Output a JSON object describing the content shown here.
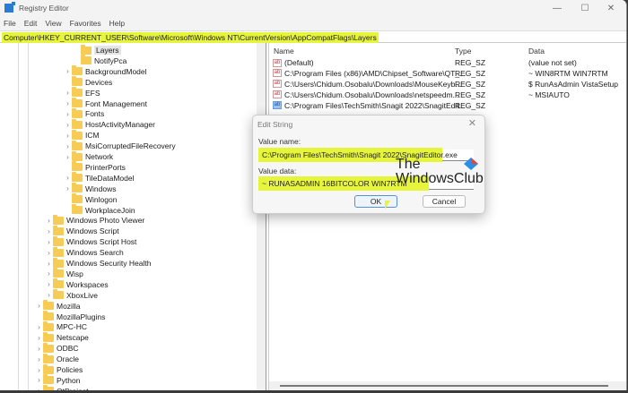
{
  "window": {
    "title": "Registry Editor",
    "minimize": "—",
    "maximize": "☐",
    "close": "✕"
  },
  "menu": [
    "File",
    "Edit",
    "View",
    "Favorites",
    "Help"
  ],
  "address": "Computer\\HKEY_CURRENT_USER\\Software\\Microsoft\\Windows NT\\CurrentVersion\\AppCompatFlags\\Layers",
  "tree": [
    {
      "label": "Layers",
      "level": 3,
      "exp": false,
      "selected": true
    },
    {
      "label": "NotifyPca",
      "level": 3,
      "exp": false
    },
    {
      "label": "BackgroundModel",
      "level": 2,
      "exp": true
    },
    {
      "label": "Devices",
      "level": 2,
      "exp": false
    },
    {
      "label": "EFS",
      "level": 2,
      "exp": true
    },
    {
      "label": "Font Management",
      "level": 2,
      "exp": true
    },
    {
      "label": "Fonts",
      "level": 2,
      "exp": true
    },
    {
      "label": "HostActivityManager",
      "level": 2,
      "exp": true
    },
    {
      "label": "ICM",
      "level": 2,
      "exp": true
    },
    {
      "label": "MsiCorruptedFileRecovery",
      "level": 2,
      "exp": true
    },
    {
      "label": "Network",
      "level": 2,
      "exp": true
    },
    {
      "label": "PrinterPorts",
      "level": 2,
      "exp": false
    },
    {
      "label": "TileDataModel",
      "level": 2,
      "exp": true
    },
    {
      "label": "Windows",
      "level": 2,
      "exp": true
    },
    {
      "label": "Winlogon",
      "level": 2,
      "exp": false
    },
    {
      "label": "WorkplaceJoin",
      "level": 2,
      "exp": false
    },
    {
      "label": "Windows Photo Viewer",
      "level": 1,
      "exp": true
    },
    {
      "label": "Windows Script",
      "level": 1,
      "exp": true
    },
    {
      "label": "Windows Script Host",
      "level": 1,
      "exp": true
    },
    {
      "label": "Windows Search",
      "level": 1,
      "exp": true
    },
    {
      "label": "Windows Security Health",
      "level": 1,
      "exp": true
    },
    {
      "label": "Wisp",
      "level": 1,
      "exp": true
    },
    {
      "label": "Workspaces",
      "level": 1,
      "exp": true
    },
    {
      "label": "XboxLive",
      "level": 1,
      "exp": true
    },
    {
      "label": "Mozilla",
      "level": 0,
      "exp": true
    },
    {
      "label": "MozillaPlugins",
      "level": 0,
      "exp": false
    },
    {
      "label": "MPC-HC",
      "level": 0,
      "exp": true
    },
    {
      "label": "Netscape",
      "level": 0,
      "exp": true
    },
    {
      "label": "ODBC",
      "level": 0,
      "exp": true
    },
    {
      "label": "Oracle",
      "level": 0,
      "exp": true
    },
    {
      "label": "Policies",
      "level": 0,
      "exp": true
    },
    {
      "label": "Python",
      "level": 0,
      "exp": true
    },
    {
      "label": "QtProject",
      "level": 0,
      "exp": true
    }
  ],
  "values": {
    "headers": {
      "name": "Name",
      "type": "Type",
      "data": "Data"
    },
    "rows": [
      {
        "name": "(Default)",
        "type": "REG_SZ",
        "data": "(value not set)"
      },
      {
        "name": "C:\\Program Files (x86)\\AMD\\Chipset_Software\\QT_...",
        "type": "REG_SZ",
        "data": "~ WIN8RTM WIN7RTM"
      },
      {
        "name": "C:\\Users\\Chidum.Osobalu\\Downloads\\MouseKeyb...",
        "type": "REG_SZ",
        "data": "$ RunAsAdmin VistaSetup"
      },
      {
        "name": "C:\\Users\\Chidum.Osobalu\\Downloads\\netspeedm...",
        "type": "REG_SZ",
        "data": "~ MSIAUTO"
      },
      {
        "name": "C:\\Program Files\\TechSmith\\Snagit 2022\\SnagitEdit...",
        "type": "REG_SZ",
        "data": "",
        "selected": true
      }
    ]
  },
  "dialog": {
    "title": "Edit String",
    "close": "✕",
    "value_name_label": "Value name:",
    "value_name": "C:\\Program Files\\TechSmith\\Snagit 2022\\SnagitEditor.exe",
    "value_data_label": "Value data:",
    "value_data": "~ RUNASADMIN 16BITCOLOR WIN7RTM",
    "ok": "OK",
    "cancel": "Cancel"
  },
  "watermark": {
    "line1": "The",
    "line2": "WindowsClub"
  }
}
